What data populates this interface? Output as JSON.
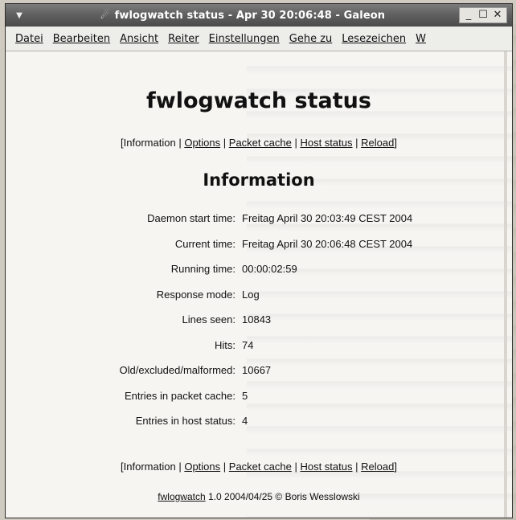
{
  "window": {
    "title": "fwlogwatch status - Apr 30 20:06:48 - Galeon",
    "controls": {
      "minimize": "_",
      "maximize": "☐",
      "close": "✕"
    }
  },
  "menubar": {
    "items": [
      {
        "label": "Datei"
      },
      {
        "label": "Bearbeiten"
      },
      {
        "label": "Ansicht"
      },
      {
        "label": "Reiter"
      },
      {
        "label": "Einstellungen"
      },
      {
        "label": "Gehe zu"
      },
      {
        "label": "Lesezeichen"
      },
      {
        "label": "W"
      }
    ]
  },
  "page": {
    "heading": "fwlogwatch status",
    "section_heading": "Information",
    "nav": {
      "open": "[",
      "close": "]",
      "separator": "|",
      "links": [
        "Information",
        "Options",
        "Packet cache",
        "Host status",
        "Reload"
      ]
    },
    "status_rows": [
      {
        "label": "Daemon start time:",
        "value": "Freitag April 30 20:03:49 CEST 2004"
      },
      {
        "label": "Current time:",
        "value": "Freitag April 30 20:06:48 CEST 2004"
      },
      {
        "label": "Running time:",
        "value": "00:00:02:59"
      },
      {
        "label": "Response mode:",
        "value": "Log"
      },
      {
        "label": "Lines seen:",
        "value": "10843"
      },
      {
        "label": "Hits:",
        "value": "74"
      },
      {
        "label": "Old/excluded/malformed:",
        "value": "10667"
      },
      {
        "label": "Entries in packet cache:",
        "value": "5"
      },
      {
        "label": "Entries in host status:",
        "value": "4"
      }
    ],
    "footer": {
      "app_link": "fwlogwatch",
      "text": "1.0 2004/04/25 © Boris Wesslowski"
    }
  }
}
